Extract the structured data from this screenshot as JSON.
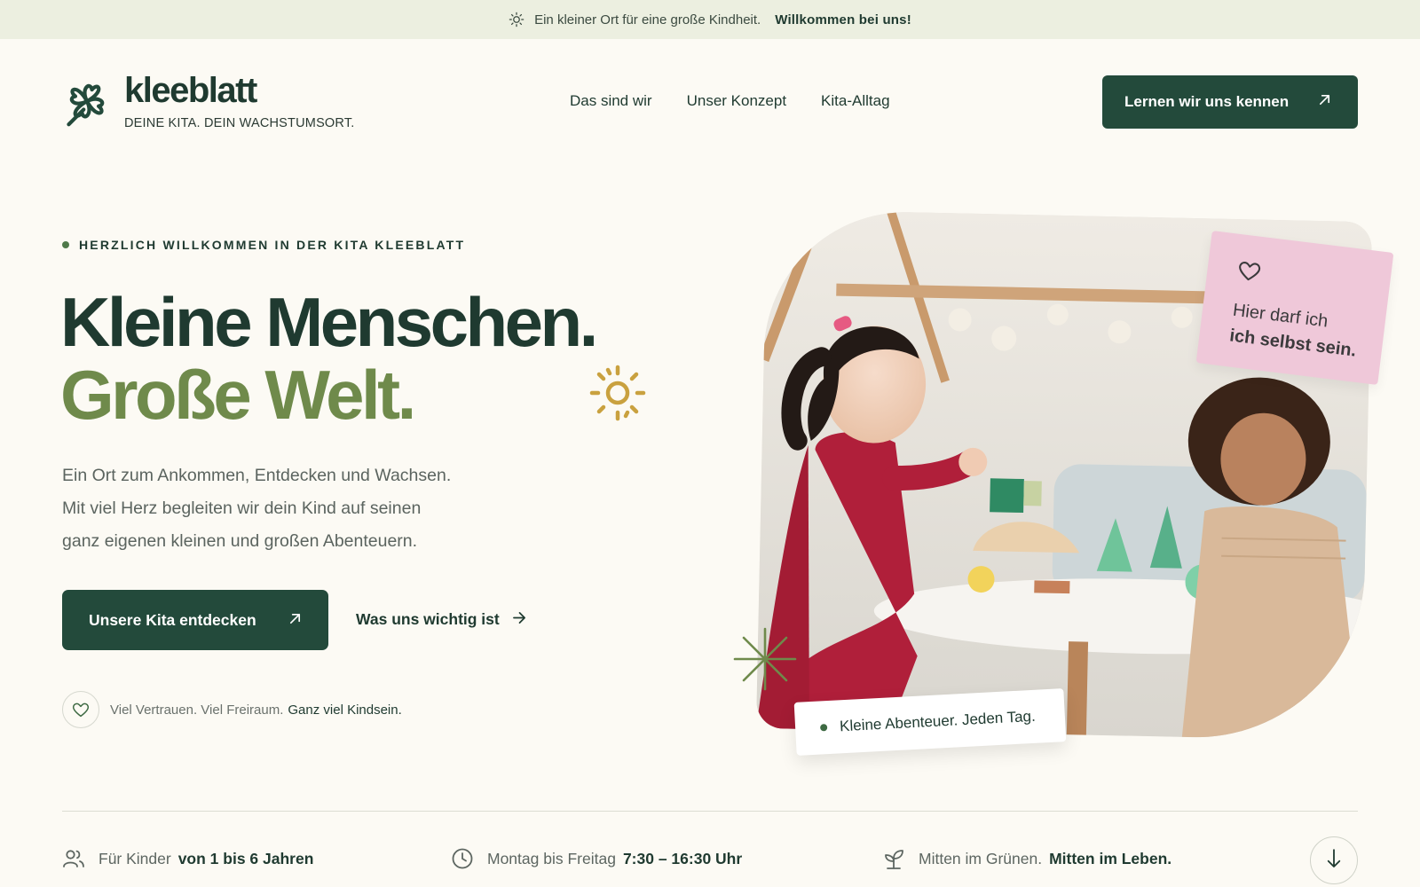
{
  "topbar": {
    "icon": "sun-icon",
    "text": "Ein kleiner Ort für eine große Kindheit.",
    "highlight": "Willkommen bei uns!"
  },
  "brand": {
    "icon": "clover-logo-icon",
    "name": "kleeblatt",
    "tagline": "DEINE KITA. DEIN WACHSTUMSORT.",
    "color": "#234a3b"
  },
  "nav": {
    "items": [
      {
        "label": "Das sind wir"
      },
      {
        "label": "Unser Konzept"
      },
      {
        "label": "Kita-Alltag"
      }
    ]
  },
  "header_cta": {
    "label": "Lernen wir uns kennen",
    "icon": "arrow-up-right-icon"
  },
  "hero": {
    "eyebrow": "HERZLICH WILLKOMMEN IN DER KITA KLEEBLATT",
    "headline_line1": "Kleine Menschen.",
    "headline_line2": "Große Welt.",
    "intro_lines": [
      "Ein Ort zum Ankommen, Entdecken und Wachsen.",
      "Mit viel Herz begleiten wir dein Kind auf seinen",
      "ganz eigenen kleinen und großen Abenteuern."
    ],
    "primary_button": "Unsere Kita entdecken",
    "secondary_link": "Was uns wichtig ist",
    "trust_light": "Viel Vertrauen. Viel Freiraum.",
    "trust_dark": "Ganz viel Kindsein.",
    "accent_green": "#6f8a4b",
    "accent_gold": "#c9a13f"
  },
  "photo": {
    "note_line1": "Hier darf ich",
    "note_line2": "ich selbst sein.",
    "note_icon": "heart-icon",
    "note_color": "#efc8d9",
    "caption": "Kleine Abenteuer. Jeden Tag."
  },
  "facts": [
    {
      "icon": "people-icon",
      "label": "Für Kinder",
      "value": "von 1 bis 6 Jahren"
    },
    {
      "icon": "clock-icon",
      "label": "Montag bis Freitag",
      "value": "7:30 – 16:30 Uhr"
    },
    {
      "icon": "sprout-icon",
      "label": "Mitten im Grünen.",
      "value": "Mitten im Leben."
    }
  ],
  "scroll": {
    "icon": "arrow-down-icon"
  }
}
